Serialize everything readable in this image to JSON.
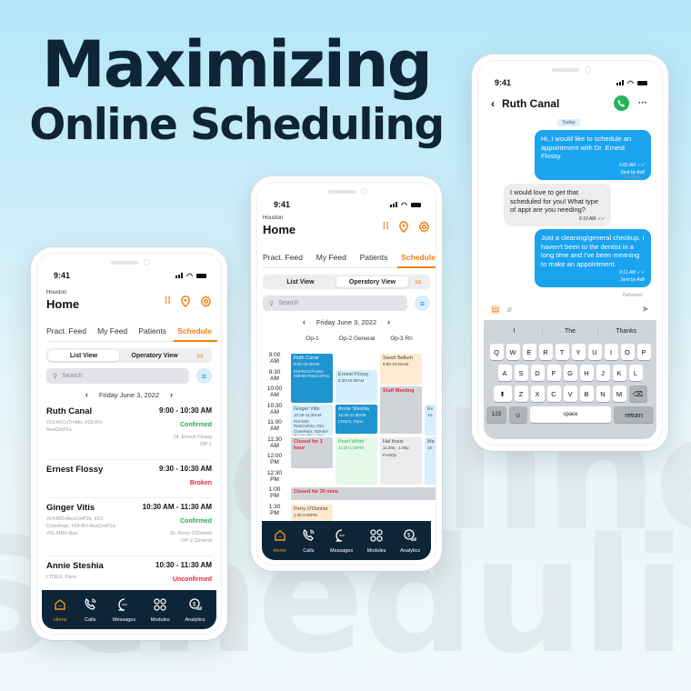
{
  "headline": {
    "line1": "Maximizing",
    "line2": "Online Scheduling"
  },
  "background_words": [
    "online",
    "Scheduling"
  ],
  "colors": {
    "accent": "#f07f10",
    "navy": "#0e2538",
    "confirmed": "#19b548",
    "alert": "#e8262f",
    "chat_blue": "#1aa3ef"
  },
  "status_time": "9:41",
  "home": {
    "location": "Houston",
    "title": "Home",
    "icons": [
      "dialpad-icon",
      "location-pin-icon",
      "gear-icon"
    ],
    "tabs": [
      "Pract. Feed",
      "My Feed",
      "Patients",
      "Schedule"
    ],
    "active_tab": "Schedule",
    "view_toggle": [
      "List View",
      "Operatory View"
    ],
    "search_placeholder": "Search",
    "date": "Friday June 3, 2022"
  },
  "list_view": {
    "appointments": [
      {
        "name": "Ruth Canal",
        "time": "9:00 - 10:30 AM",
        "codes": "#19-RrCnTrvMo, #29-BV-ResCmP1s",
        "status": "Confirmed",
        "doctor": "Dr. Ernest Flossy",
        "op": "OP-1"
      },
      {
        "name": "Ernest Flossy",
        "time": "9:30 - 10:30 AM",
        "codes": "",
        "status": "Broken",
        "doctor": "",
        "op": ""
      },
      {
        "name": "Ginger Vitis",
        "time": "10:30 AM - 11:30 AM",
        "codes": "#14-MO-ResCmP2s, #21-CrwnRepr, #29-BV-ResCmP1s, #31-MBV-Res",
        "status": "Confirmed",
        "doctor": "Dr. Perry O'Dontist",
        "op": "OP-2 General"
      },
      {
        "name": "Annie Steshia",
        "time": "10:30 - 11:30 AM",
        "codes": "LTDEX, Pano",
        "status": "Unconfirmed",
        "doctor": "",
        "op": ""
      }
    ]
  },
  "operatory_view": {
    "columns": [
      "Op-1",
      "Op-2 General",
      "Op-3 Rn"
    ],
    "times": [
      "9:00 AM",
      "9:30 AM",
      "10:00 AM",
      "10:30 AM",
      "11:00 AM",
      "11:30 AM",
      "12:00 PM",
      "12:30 PM",
      "1:00 PM",
      "1:30 PM"
    ],
    "blocks": [
      {
        "name": "Ruth Canal",
        "time": "9:00-10:30AM",
        "detail": "#19-RrCnTrvMo, #29-BV-ResCmP1s"
      },
      {
        "name": "Ernest Flossy",
        "time": "9:30-10:30AM",
        "detail": ""
      },
      {
        "name": "Sarah Bellum",
        "time": "9:00-10:00AM",
        "detail": ""
      },
      {
        "name": "Staff Meeting",
        "time": "",
        "detail": ""
      },
      {
        "name": "Ginger Vitis",
        "time": "10:30-11:30AM",
        "detail": "#14-MO-ResCmP2s, #21-CrwnRepr, #29-BV-ResCmP1s, #31-"
      },
      {
        "name": "Annie Steshia",
        "time": "10:30-11:30AM",
        "detail": "LTDEX, Pano"
      },
      {
        "name": "Ev",
        "time": "10:",
        "detail": ""
      },
      {
        "name": "Closed for 1 hour",
        "time": "",
        "detail": ""
      },
      {
        "name": "Pearl White",
        "time": "11:30-1:30PM",
        "detail": ""
      },
      {
        "name": "Hal Itosis",
        "time": "11:30a - 1:00p",
        "detail": "PostOp"
      },
      {
        "name": "Ma",
        "time": "10:",
        "detail": ""
      },
      {
        "name": "Closed for 30 mins",
        "time": "",
        "detail": ""
      },
      {
        "name": "Perry O'Dontist",
        "time": "1:30-2:00PM",
        "detail": ""
      }
    ]
  },
  "nav": [
    {
      "label": "Home",
      "icon": "home-icon",
      "active": true
    },
    {
      "label": "Calls",
      "icon": "phone-icon",
      "active": false
    },
    {
      "label": "Messages",
      "icon": "chat-bubble-icon",
      "active": false
    },
    {
      "label": "Modules",
      "icon": "modules-grid-icon",
      "active": false
    },
    {
      "label": "Analytics",
      "icon": "analytics-icon",
      "active": false
    }
  ],
  "chat": {
    "contact": "Ruth Canal",
    "day_label": "Today",
    "messages": [
      {
        "from": "patient",
        "text": "Hi, I would like to schedule an appointment with Dr. Ernest Flossy",
        "time": "9:02 AM",
        "sent_by": "Sent by Adit",
        "receipt": "Delivered"
      },
      {
        "from": "office",
        "text": "I would love to get that scheduled for you! What type of appt are you needing?",
        "time": "9:10 AM"
      },
      {
        "from": "patient",
        "text": "Just a cleaning/general checkup. I haven't been to the dentist in a long time and I've been meaning to make an appointment.",
        "time": "9:11 AM",
        "sent_by": "Sent by Adit",
        "receipt": "Delivered"
      }
    ],
    "suggestions": [
      "I",
      "The",
      "Thanks"
    ],
    "keyboard": {
      "row1": [
        "Q",
        "W",
        "E",
        "R",
        "T",
        "Y",
        "U",
        "I",
        "O",
        "P"
      ],
      "row2": [
        "A",
        "S",
        "D",
        "F",
        "G",
        "H",
        "J",
        "K",
        "L"
      ],
      "row3": [
        "Z",
        "X",
        "C",
        "V",
        "B",
        "N",
        "M"
      ],
      "numbers": "123",
      "space": "space",
      "return": "return"
    }
  }
}
